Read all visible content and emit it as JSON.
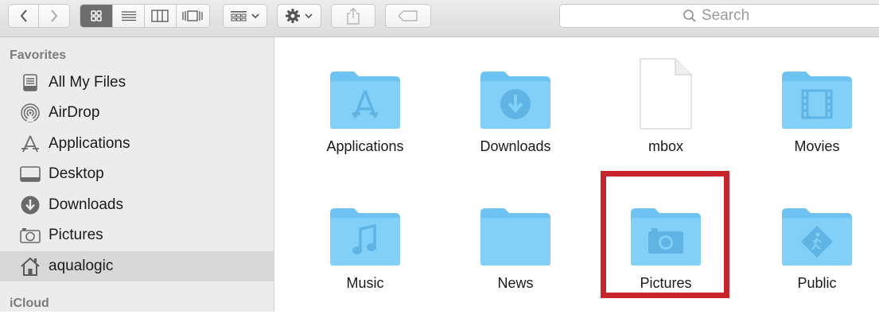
{
  "toolbar": {
    "nav_back_icon": "chevron-left-icon",
    "nav_forward_icon": "chevron-right-icon",
    "view_modes": [
      "icon-view",
      "list-view",
      "column-view",
      "cover-flow-view"
    ],
    "active_view": "icon-view",
    "arrange_icon": "arrange-grid-icon",
    "action_icon": "gear-icon",
    "share_icon": "share-icon",
    "tag_icon": "tag-icon",
    "search_placeholder": "Search"
  },
  "sidebar": {
    "favorites_header": "Favorites",
    "items": [
      {
        "label": "All My Files",
        "icon": "all-files-icon"
      },
      {
        "label": "AirDrop",
        "icon": "airdrop-icon"
      },
      {
        "label": "Applications",
        "icon": "applications-icon"
      },
      {
        "label": "Desktop",
        "icon": "desktop-icon"
      },
      {
        "label": "Downloads",
        "icon": "downloads-icon"
      },
      {
        "label": "Pictures",
        "icon": "camera-icon"
      },
      {
        "label": "aqualogic",
        "icon": "home-icon",
        "selected": true
      }
    ],
    "icloud_header": "iCloud"
  },
  "files": [
    {
      "name": "Applications",
      "icon": "folder-applications-icon"
    },
    {
      "name": "Downloads",
      "icon": "folder-downloads-icon"
    },
    {
      "name": "mbox",
      "icon": "document-icon"
    },
    {
      "name": "Movies",
      "icon": "folder-movies-icon"
    },
    {
      "name": "Music",
      "icon": "folder-music-icon"
    },
    {
      "name": "News",
      "icon": "folder-icon"
    },
    {
      "name": "Pictures",
      "icon": "folder-pictures-icon",
      "highlighted": true
    },
    {
      "name": "Public",
      "icon": "folder-public-icon"
    }
  ],
  "colors": {
    "folder": "#7ccbf5",
    "highlight": "#c8242c",
    "sidebar_bg": "#ececec"
  }
}
